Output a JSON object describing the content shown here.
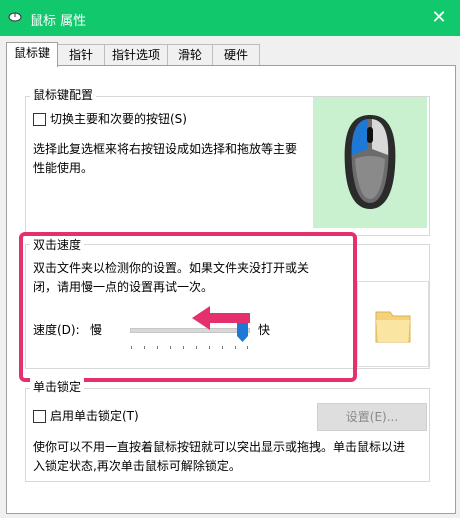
{
  "window": {
    "title": "鼠标 属性",
    "close_glyph": "✕"
  },
  "tabs": [
    {
      "label": "鼠标键"
    },
    {
      "label": "指针"
    },
    {
      "label": "指针选项"
    },
    {
      "label": "滑轮"
    },
    {
      "label": "硬件"
    }
  ],
  "button_config": {
    "legend": "鼠标键配置",
    "swap_checkbox_label": "切换主要和次要的按钮(S)",
    "description_line1": "选择此复选框来将右按钮设成如选择和拖放等主要",
    "description_line2": "性能使用。"
  },
  "double_click": {
    "legend": "双击速度",
    "description_line1": "双击文件夹以检测你的设置。如果文件夹没打开或关",
    "description_line2": "闭，请用慢一点的设置再试一次。",
    "speed_label": "速度(D):",
    "slow_label": "慢",
    "fast_label": "快",
    "speed_level_fraction": 0.95
  },
  "click_lock": {
    "legend": "单击锁定",
    "checkbox_label": "启用单击锁定(T)",
    "settings_button": "设置(E)...",
    "description_line1": "使你可以不用一直按着鼠标按钮就可以突出显示或拖拽。单击鼠标以进",
    "description_line2": "入锁定状态,再次单击鼠标可解除锁定。"
  },
  "colors": {
    "titlebar": "#11c86c",
    "highlight": "#e4306b",
    "mouse_panel_bg": "#c9f0cf",
    "mouse_accent": "#1e78d6"
  }
}
